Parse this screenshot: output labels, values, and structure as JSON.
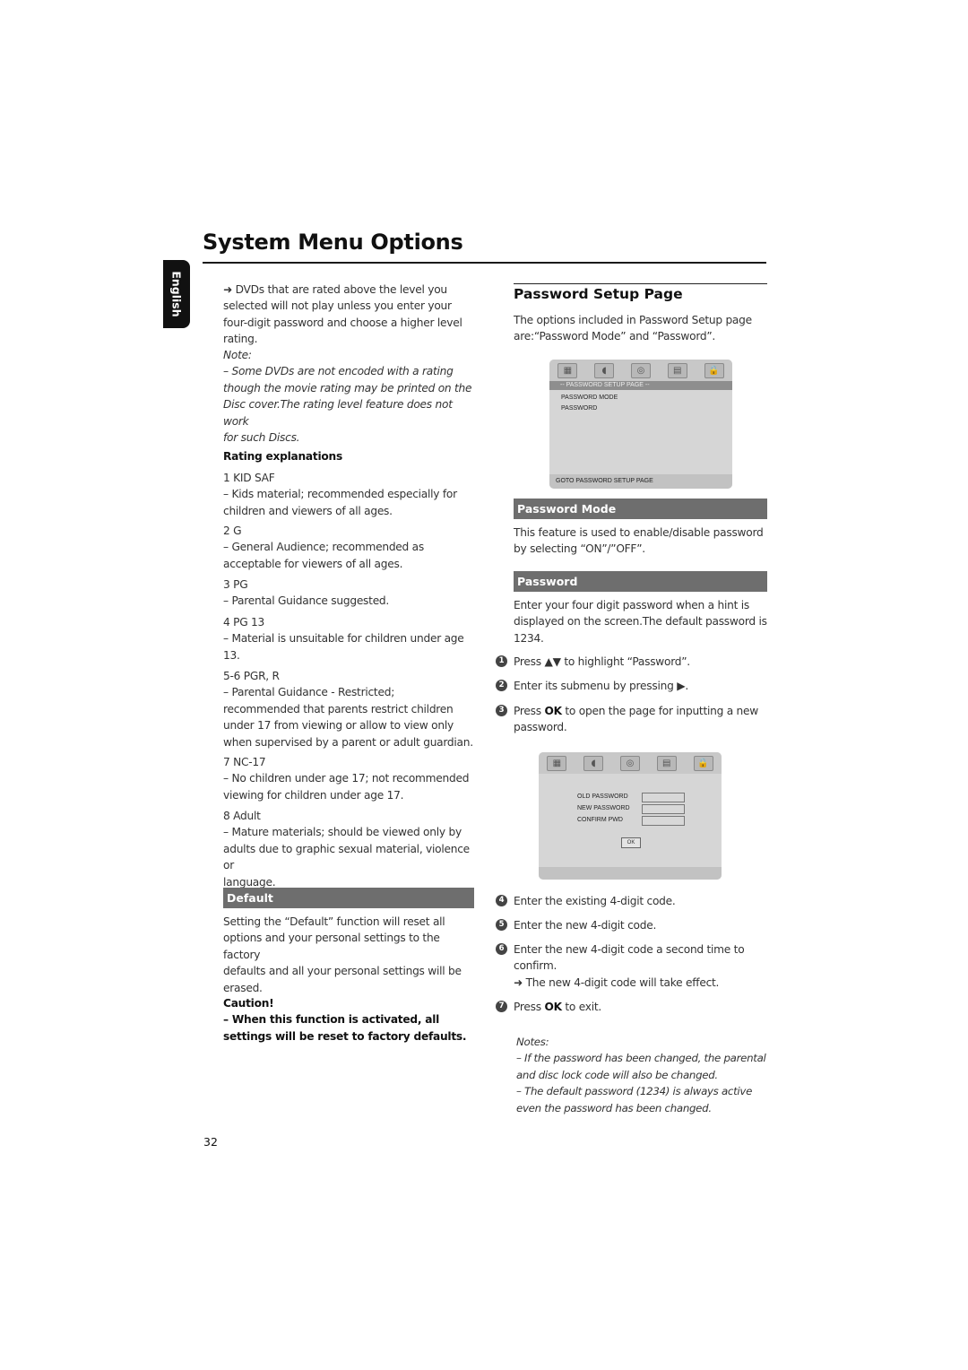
{
  "header": {
    "title": "System Menu Options",
    "language_tab": "English"
  },
  "left": {
    "intro_arrow": "➜",
    "intro": "DVDs that are rated above the level you selected will not play unless you enter your four-digit password and choose a higher level rating.",
    "note_label": "Note:",
    "note_lines": [
      "–   Some DVDs are not encoded with a rating",
      "though the movie rating may be printed on the",
      "Disc cover.The rating level feature does not work",
      "for such Discs."
    ],
    "rating_heading": "Rating explanations",
    "ratings": [
      {
        "label": "1 KID SAF",
        "desc": [
          "–   Kids material; recommended especially for",
          "children and viewers of all ages."
        ]
      },
      {
        "label": "2 G",
        "desc": [
          "–   General Audience; recommended as",
          "acceptable for viewers of all ages."
        ]
      },
      {
        "label": "3 PG",
        "desc": [
          "–   Parental Guidance suggested."
        ]
      },
      {
        "label": "4 PG 13",
        "desc": [
          "–   Material is unsuitable for children under age",
          "13."
        ]
      },
      {
        "label": "5-6 PGR, R",
        "desc": [
          "–   Parental Guidance - Restricted;",
          "recommended that parents restrict children",
          "under 17 from viewing or allow to view only",
          "when supervised by a parent or adult guardian."
        ]
      },
      {
        "label": "7 NC-17",
        "desc": [
          "–   No children under age 17; not recommended",
          "viewing for children under age 17."
        ]
      },
      {
        "label": "8 Adult",
        "desc": [
          "–   Mature materials; should be viewed only by",
          "adults due to graphic sexual material, violence or",
          "language."
        ]
      }
    ],
    "default_bar": "Default",
    "default_text": [
      "Setting the “Default” function will reset all",
      "options and your personal settings to the factory",
      "defaults and all your personal settings will be",
      "erased."
    ],
    "caution_label": "Caution!",
    "caution_lines": [
      "–  When this function is activated, all",
      "settings will be reset to factory defaults."
    ]
  },
  "right": {
    "section_title": "Password Setup Page",
    "section_intro": [
      "The options included in Password Setup page",
      "are:“Password Mode” and “Password”."
    ],
    "osd1": {
      "icons": [
        "general-setup-icon",
        "audio-setup-icon",
        "video-setup-icon",
        "preference-icon",
        "lock-icon"
      ],
      "strip": "-- PASSWORD SETUP PAGE --",
      "items": [
        "PASSWORD MODE",
        "PASSWORD"
      ],
      "footer": "GOTO PASSWORD SETUP PAGE"
    },
    "mode_bar": "Password Mode",
    "mode_text": [
      "This feature is used to enable/disable password",
      "by selecting “ON”/”OFF”."
    ],
    "password_bar": "Password",
    "password_text": [
      "Enter your four digit password when a hint is",
      "displayed on the screen.The default password is",
      "1234."
    ],
    "steps_a": [
      {
        "num": "1",
        "pre": "Press ▲▼  to highlight “Password”.",
        "bold": "",
        "post": ""
      },
      {
        "num": "2",
        "pre": "Enter its submenu by pressing ▶.",
        "bold": "",
        "post": ""
      },
      {
        "num": "3",
        "pre": "Press ",
        "bold": "OK",
        "post": " to open the page for inputting a new password."
      }
    ],
    "osd2": {
      "fields": [
        "OLD PASSWORD",
        "NEW PASSWORD",
        "CONFIRM PWD"
      ],
      "ok": "OK"
    },
    "steps_b": [
      {
        "num": "4",
        "text": "Enter the existing 4-digit code."
      },
      {
        "num": "5",
        "text": "Enter the new 4-digit code."
      },
      {
        "num": "6",
        "text": "Enter the new 4-digit code a second time to confirm.",
        "result": "➜ The new 4-digit code will take effect."
      }
    ],
    "step7": {
      "num": "7",
      "pre": "Press ",
      "bold": "OK",
      "post": " to exit."
    },
    "notes_label": "Notes:",
    "notes_lines": [
      "–   If the password has been changed, the parental",
      "and disc lock code will also be changed.",
      "–   The default password (1234) is always active",
      "even the password has been changed."
    ]
  },
  "footer": {
    "page_number": "32"
  }
}
